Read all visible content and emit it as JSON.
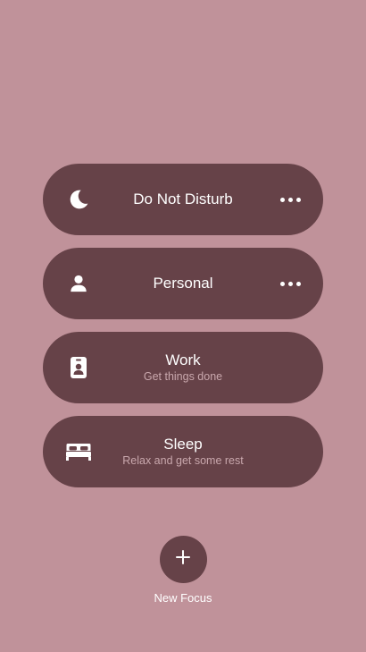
{
  "colors": {
    "background": "#c0929a",
    "pill": "#664248",
    "title": "#ffffff",
    "subtitle": "#c9a8ad"
  },
  "focus_modes": [
    {
      "icon": "moon-icon",
      "title": "Do Not Disturb",
      "subtitle": "",
      "has_more": true
    },
    {
      "icon": "person-icon",
      "title": "Personal",
      "subtitle": "",
      "has_more": true
    },
    {
      "icon": "badge-icon",
      "title": "Work",
      "subtitle": "Get things done",
      "has_more": false
    },
    {
      "icon": "bed-icon",
      "title": "Sleep",
      "subtitle": "Relax and get some rest",
      "has_more": false
    }
  ],
  "new_focus": {
    "icon": "plus-icon",
    "label": "New Focus"
  }
}
